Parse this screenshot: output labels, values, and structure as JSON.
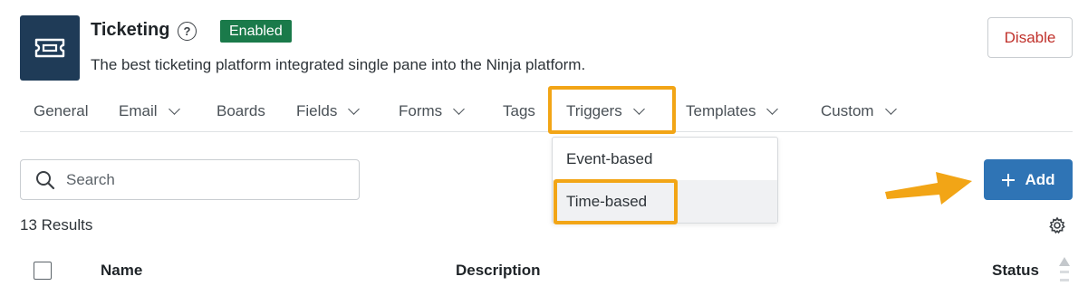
{
  "header": {
    "title": "Ticketing",
    "status_badge": "Enabled",
    "description": "The best ticketing platform integrated single pane into the Ninja platform.",
    "disable_label": "Disable",
    "icon": "ticket-icon",
    "help_glyph": "?"
  },
  "tabs": [
    {
      "label": "General"
    },
    {
      "label": "Email"
    },
    {
      "label": "Boards"
    },
    {
      "label": "Fields"
    },
    {
      "label": "Forms"
    },
    {
      "label": "Tags"
    },
    {
      "label": "Triggers"
    },
    {
      "label": "Templates"
    },
    {
      "label": "Custom"
    }
  ],
  "dropdown": {
    "items": [
      {
        "label": "Event-based"
      },
      {
        "label": "Time-based"
      }
    ]
  },
  "search": {
    "placeholder": "Search"
  },
  "toolbar": {
    "add_label": "Add"
  },
  "results": {
    "count_label": "13 Results"
  },
  "table": {
    "columns": [
      {
        "label": "Name"
      },
      {
        "label": "Description"
      },
      {
        "label": "Status"
      }
    ]
  },
  "colors": {
    "app_icon_bg": "#1f3b57",
    "badge_bg": "#1a7a4a",
    "disable_text": "#c0312b",
    "primary": "#2f74b5",
    "annotation": "#f2a516"
  }
}
